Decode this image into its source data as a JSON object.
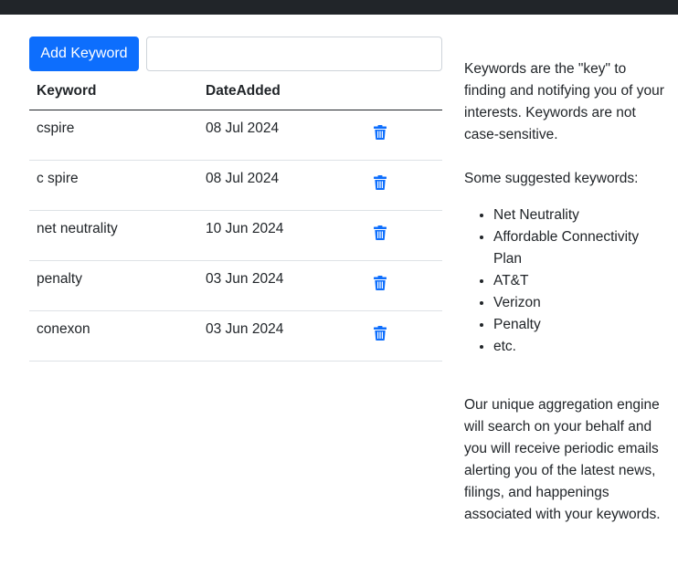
{
  "controls": {
    "add_button_label": "Add Keyword",
    "input_value": "",
    "input_placeholder": ""
  },
  "table": {
    "headers": [
      "Keyword",
      "DateAdded",
      ""
    ],
    "rows": [
      {
        "keyword": "cspire",
        "date": "08 Jul 2024",
        "icon": "trash-icon"
      },
      {
        "keyword": "c spire",
        "date": "08 Jul 2024",
        "icon": "trash-icon"
      },
      {
        "keyword": "net neutrality",
        "date": "10 Jun 2024",
        "icon": "trash-icon"
      },
      {
        "keyword": "penalty",
        "date": "03 Jun 2024",
        "icon": "trash-icon"
      },
      {
        "keyword": "conexon",
        "date": "03 Jun 2024",
        "icon": "trash-icon"
      }
    ]
  },
  "sidebar": {
    "intro": "Keywords are the \"key\" to finding and notifying you of your interests. Keywords are not case-sensitive.",
    "suggested_heading": "Some suggested keywords:",
    "suggestions": [
      "Net Neutrality",
      "Affordable Connectivity Plan",
      "AT&T",
      "Verizon",
      "Penalty",
      "etc."
    ],
    "outro": "Our unique aggregation engine will search on your behalf and you will receive periodic emails alerting you of the latest news, filings, and happenings associated with your keywords."
  },
  "colors": {
    "primary": "#0d6efd",
    "topbar": "#212529",
    "text": "#212529",
    "divider": "#dee2e6"
  }
}
